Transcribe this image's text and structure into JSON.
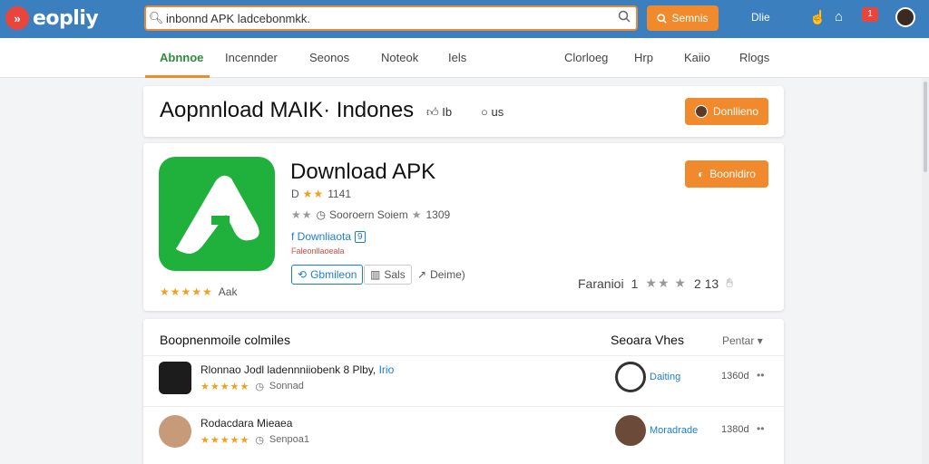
{
  "brand": {
    "logo_mark": "»",
    "name": "eopliy"
  },
  "search": {
    "value": "inbonnd APK ladcebonmkk.",
    "button_label": "Semnis"
  },
  "topbar": {
    "link": "Dlie",
    "badge": "1"
  },
  "nav": {
    "tabs": [
      {
        "label": "Abnnoe"
      },
      {
        "label": "Incennder"
      },
      {
        "label": "Seonos"
      },
      {
        "label": "Noteok"
      },
      {
        "label": "Iels"
      }
    ],
    "right": [
      {
        "label": "Clorloeg"
      },
      {
        "label": "Hrp"
      },
      {
        "label": "Kaiio"
      },
      {
        "label": "Rlogs"
      }
    ]
  },
  "title_card": {
    "title": "Aopnnload MAIK·  Indones",
    "meta1": "Ib",
    "meta2": "us",
    "button_label": "Donllieno"
  },
  "app": {
    "name": "Download APK",
    "rating_prefix": "D",
    "rating_count": "1141",
    "size_text": "Sooroern Soiem",
    "downloads": "1309",
    "link_text": "f Downliaota",
    "link_badge": "9",
    "sub_text": "Faleonllaoeala",
    "btn_primary": "Gbmileon",
    "btn_share": "Sals",
    "btn_more": "Deime)",
    "install_label": "Boonldiro",
    "left_rating_label": "Aak",
    "right_rating_label": "Faranioi",
    "right_rating_value": "1",
    "right_rating_num": "2 13",
    "colors": {
      "icon_bg": "#20b03c",
      "accent": "#f08a2c"
    }
  },
  "list": {
    "title": "Boopnenmoile colmiles",
    "right_title": "Seoara Vhes",
    "sort_label": "Pentar",
    "items": [
      {
        "name": "Rlonnao Jodl ladennniiobenk 8 Plby,",
        "name_link": "Irio",
        "sub": "Sonnad",
        "developer": "Daiting",
        "size": "1360d"
      },
      {
        "name": "Rodacdara Mieaea",
        "name_link": "",
        "sub": "Senpoa1",
        "developer": "Moradrade",
        "size": "1380d"
      }
    ]
  }
}
